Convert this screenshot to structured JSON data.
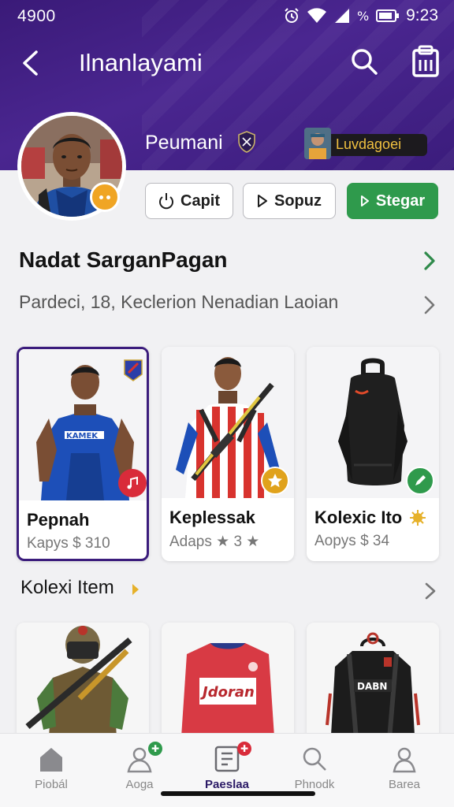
{
  "status": {
    "left": "4900",
    "time": "9:23"
  },
  "topbar": {
    "title": "Ilnanlayami"
  },
  "profile": {
    "name": "Peumani",
    "rank_label": "Luvdagoei"
  },
  "actions": {
    "capit": "Capit",
    "sopuz": "Sopuz",
    "stegar": "Stegar"
  },
  "section": {
    "title": "Nadat SarganPagan",
    "subtitle": "Pardeci, 18, Keclerion Nenadian Laoian"
  },
  "cards": [
    {
      "title": "Pepnah",
      "sub": "Kapys $ 310"
    },
    {
      "title": "Keplessak",
      "sub": "Adaps ★ 3 ★"
    },
    {
      "title": "Kolexic Ito",
      "sub": "Aopys $ 34"
    }
  ],
  "section2": {
    "title": "Kolexi Item"
  },
  "nav": [
    {
      "label": "Piobál"
    },
    {
      "label": "Aoga"
    },
    {
      "label": "Paeslaa"
    },
    {
      "label": "Phnodk"
    },
    {
      "label": "Barea"
    }
  ],
  "colors": {
    "header": "#3f1f86",
    "accent_green": "#2f9a4c",
    "badge_orange": "#f0a524",
    "badge_red": "#d92b3a",
    "badge_gold": "#e0a21c",
    "badge_green": "#2f9a4c"
  },
  "icons": [
    "back-icon",
    "search-icon",
    "clipboard-icon",
    "shield-icon",
    "power-icon",
    "play-icon",
    "chevron-right-icon",
    "home-icon",
    "user-icon",
    "document-icon",
    "profile-icon"
  ]
}
